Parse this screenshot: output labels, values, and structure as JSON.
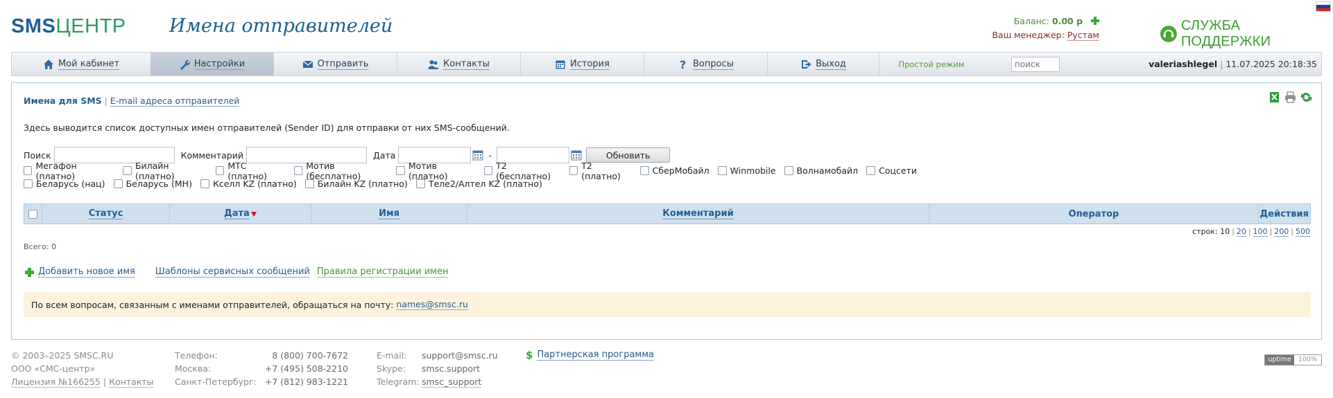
{
  "brand": {
    "part1": "SMS",
    "part2": "ЦЕНТР"
  },
  "page_title": "Имена отправителей",
  "balance": {
    "label": "Баланс:",
    "value": "0.00 р"
  },
  "manager": {
    "label": "Ваш менеджер:",
    "name": "Рустам"
  },
  "support": {
    "label": "СЛУЖБА ПОДДЕРЖКИ"
  },
  "nav": {
    "items": [
      {
        "label": "Мой кабинет",
        "icon": "home-icon"
      },
      {
        "label": "Настройки",
        "icon": "wrench-icon",
        "active": true
      },
      {
        "label": "Отправить",
        "icon": "envelope-icon"
      },
      {
        "label": "Контакты",
        "icon": "contacts-icon"
      },
      {
        "label": "История",
        "icon": "calendar-icon"
      },
      {
        "label": "Вопросы",
        "icon": "question-icon"
      },
      {
        "label": "Выход",
        "icon": "logout-icon"
      }
    ],
    "mode": "Простой режим",
    "search_placeholder": "поиск",
    "user": "valeriashlegel",
    "datetime": "11.07.2025 20:18:35"
  },
  "subtabs": {
    "current": "Имена для SMS",
    "other": "E-mail адреса отправителей"
  },
  "intro": "Здесь выводится список доступных имен отправителей (Sender ID) для отправки от них SMS-сообщений.",
  "filters": {
    "search_label": "Поиск",
    "comment_label": "Комментарий",
    "date_label": "Дата",
    "dash": "-",
    "refresh_label": "Обновить"
  },
  "operators": {
    "row1": [
      "Мегафон (платно)",
      "Билайн (платно)",
      "МТС (платно)",
      "Мотив (бесплатно)",
      "Мотив (платно)",
      "T2 (бесплатно)",
      "T2 (платно)",
      "СберМобайл",
      "Winmobile",
      "Волнамобайл",
      "Соцсети"
    ],
    "row2": [
      "Беларусь (нац)",
      "Беларусь (МН)",
      "Кселл KZ (платно)",
      "Билайн KZ (платно)",
      "Теле2/Алтел KZ (платно)"
    ]
  },
  "table": {
    "columns": {
      "status": "Статус",
      "date": "Дата",
      "name": "Имя",
      "comment": "Комментарий",
      "operator": "Оператор",
      "actions": "Действия"
    }
  },
  "pager": {
    "label": "строк:",
    "current": "10",
    "options": [
      "20",
      "100",
      "200",
      "500"
    ]
  },
  "total": "Всего: 0",
  "actions": {
    "add": "Добавить новое имя",
    "templates": "Шаблоны сервисных сообщений",
    "rules": "Правила регистрации имен"
  },
  "notice": {
    "text": "По всем вопросам, связанным с именами отправителей, обращаться на почту:",
    "email": "names@smsc.ru"
  },
  "footer": {
    "copyright": "© 2003–2025 SMSC.RU",
    "company": "ООО «СМС-центр»",
    "license": "Лицензия №166255",
    "contacts": "Контакты",
    "phones": [
      {
        "label": "Телефон:",
        "value": "8 (800) 700-7672"
      },
      {
        "label": "Москва:",
        "value": "+7 (495) 508-2210"
      },
      {
        "label": "Санкт-Петербург:",
        "value": "+7 (812) 983-1221"
      }
    ],
    "contacts_list": [
      {
        "label": "E-mail:",
        "value": "support@smsc.ru"
      },
      {
        "label": "Skype:",
        "value": "smsc.support"
      },
      {
        "label": "Telegram:",
        "value": "smsc_support"
      }
    ],
    "partner": "Партнерская программа",
    "uptime": {
      "label": "uptime",
      "value": "100%"
    }
  },
  "colors": {
    "brand_blue": "#1f5f95",
    "brand_green": "#2d9b5a",
    "accent_green": "#3aa83a",
    "notice_bg": "#fdf3dd"
  }
}
